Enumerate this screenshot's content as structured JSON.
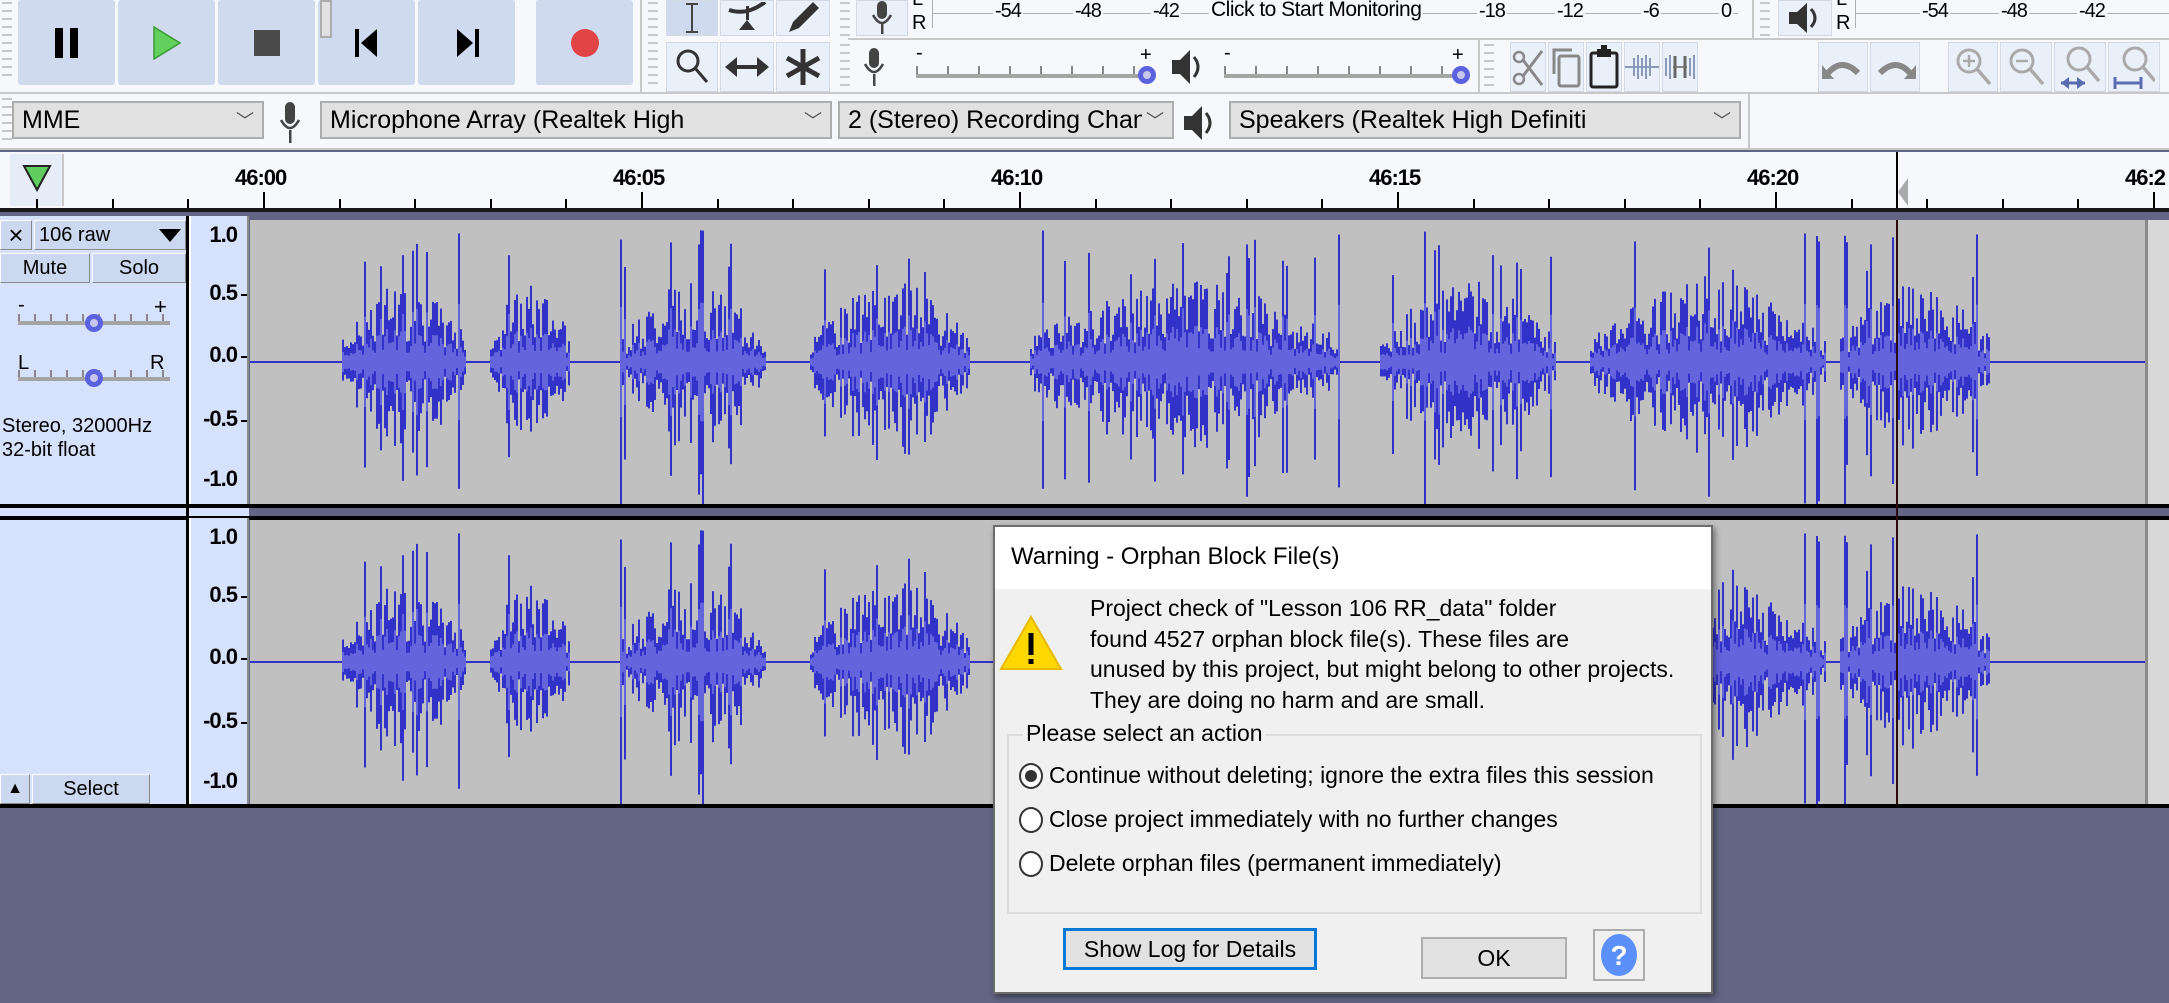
{
  "transport": {
    "buttons": [
      {
        "name": "pause",
        "label": "Pause"
      },
      {
        "name": "play",
        "label": "Play"
      },
      {
        "name": "stop",
        "label": "Stop"
      },
      {
        "name": "skip-to-start",
        "label": "Skip to Start"
      },
      {
        "name": "skip-to-end",
        "label": "Skip to End"
      },
      {
        "name": "record",
        "label": "Record"
      }
    ]
  },
  "tools": {
    "row1": [
      "selection-tool",
      "envelope-tool",
      "draw-tool"
    ],
    "row2": [
      "zoom-tool",
      "time-shift-tool",
      "multi-tool"
    ],
    "active": "selection-tool"
  },
  "recording_meter": {
    "left_label": "L",
    "right_label": "R",
    "scale": [
      "-54",
      "-48",
      "-42",
      "-18",
      "-12",
      "-6",
      "0"
    ],
    "monitor_label": "Click to Start Monitoring"
  },
  "playback_meter": {
    "left_label": "L",
    "right_label": "R",
    "scale": [
      "-54",
      "-48",
      "-42"
    ]
  },
  "mixer": {
    "recording_volume": {
      "minus": "-",
      "plus": "+",
      "value": 1.0
    },
    "playback_volume": {
      "minus": "-",
      "plus": "+",
      "value": 1.0
    }
  },
  "edit_toolbar": [
    "cut",
    "copy",
    "paste",
    "trim-audio",
    "silence-audio",
    "undo",
    "redo",
    "zoom-in",
    "zoom-out",
    "fit-selection",
    "fit-project"
  ],
  "device_toolbar": {
    "host": "MME",
    "recording_device": "Microphone Array (Realtek High",
    "recording_channels": "2 (Stereo) Recording Chann",
    "playback_device": "Speakers (Realtek High Definiti"
  },
  "timeline": {
    "labels": [
      "46:00",
      "46:05",
      "46:10",
      "46:15",
      "46:20",
      "46:2"
    ]
  },
  "track": {
    "name": "106 raw",
    "close": "×",
    "mute": "Mute",
    "solo": "Solo",
    "gain": {
      "minus": "-",
      "plus": "+",
      "value": 0.5
    },
    "pan": {
      "left": "L",
      "right": "R",
      "value": 0.5
    },
    "info_line1": "Stereo, 32000Hz",
    "info_line2": "32-bit float",
    "select": "Select",
    "collapse": "▲",
    "ruler_labels": [
      "1.0",
      "0.5",
      "0.0",
      "-0.5",
      "-1.0"
    ]
  },
  "dialog": {
    "title": "Warning - Orphan Block File(s)",
    "message_lines": [
      "Project check of \"Lesson 106 RR_data\" folder",
      "found 4527 orphan block file(s). These files are",
      "unused by this project, but might belong to other projects.",
      "They are doing no harm and are small."
    ],
    "group_label": "Please select an action",
    "options": [
      {
        "label": "Continue without deleting; ignore the extra files this session",
        "checked": true
      },
      {
        "label": "Close project immediately with no further changes",
        "checked": false
      },
      {
        "label": "Delete orphan files (permanent immediately)",
        "checked": false
      }
    ],
    "show_log_button": "Show Log for Details",
    "ok_button": "OK",
    "help_button": "?"
  },
  "colors": {
    "waveform": "#3232c8",
    "waveform_rms": "#6464dc",
    "track_bg": "#c0c0c0",
    "panel_bg": "#d6e2fb",
    "workspace": "#626684",
    "focus_blue": "#0078d7"
  }
}
